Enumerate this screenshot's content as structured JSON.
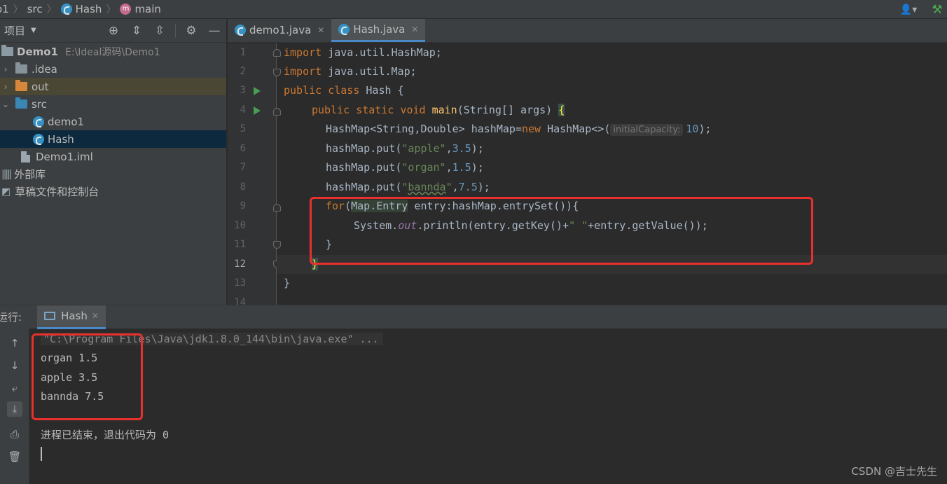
{
  "breadcrumb": {
    "project": "o1",
    "src": "src",
    "file": "Hash",
    "method": "main"
  },
  "project_panel": {
    "title": "项目",
    "tree": [
      {
        "label": "Demo1",
        "path": "E:\\Ideal源码\\Demo1"
      },
      {
        "label": ".idea"
      },
      {
        "label": "out"
      },
      {
        "label": "src"
      },
      {
        "label": "demo1"
      },
      {
        "label": "Hash"
      },
      {
        "label": "Demo1.iml"
      },
      {
        "label": "外部库"
      },
      {
        "label": "草稿文件和控制台"
      }
    ]
  },
  "editor": {
    "tabs": [
      {
        "label": "demo1.java"
      },
      {
        "label": "Hash.java"
      }
    ],
    "line_numbers": [
      "1",
      "2",
      "3",
      "4",
      "5",
      "6",
      "7",
      "8",
      "9",
      "10",
      "11",
      "12",
      "13",
      "14"
    ],
    "current_line": "12",
    "code": {
      "l1_kw": "import",
      "l1_rest": " java.util.HashMap;",
      "l2_kw": "import",
      "l2_rest": " java.util.Map;",
      "l3_kw": "public class",
      "l3_rest": " Hash {",
      "l4_kw": "public static void",
      "l4_fn": "main",
      "l4_rest": "(String[] args) ",
      "l4_brace": "{",
      "l5_a": "HashMap<String,Double> hashMap=",
      "l5_kw": "new",
      "l5_b": " HashMap<>(",
      "l5_hint": "initialCapacity:",
      "l5_num": "10",
      "l5_c": ");",
      "l6_a": "hashMap.put(",
      "l6_str": "\"apple\"",
      "l6_b": ",",
      "l6_num": "3.5",
      "l6_c": ");",
      "l7_a": "hashMap.put(",
      "l7_str": "\"organ\"",
      "l7_b": ",",
      "l7_num": "1.5",
      "l7_c": ");",
      "l8_a": "hashMap.put(",
      "l8_str_q1": "\"",
      "l8_str": "bannda",
      "l8_str_q2": "\"",
      "l8_b": ",",
      "l8_num": "7.5",
      "l8_c": ");",
      "l9_kw": "for",
      "l9_a": "(",
      "l9_hl": "Map.Entry",
      "l9_b": " entry:hashMap.entrySet()){",
      "l10_a": "System.",
      "l10_itl": "out",
      "l10_b": ".println(entry.getKey()+",
      "l10_str": "\" \"",
      "l10_c": "+entry.getValue());",
      "l11": "}",
      "l12": "}",
      "l13": "}"
    }
  },
  "run_panel": {
    "label": "运行:",
    "tab": "Hash",
    "command": "\"C:\\Program Files\\Java\\jdk1.8.0_144\\bin\\java.exe\" ...",
    "output": [
      "organ 1.5",
      "apple 3.5",
      "bannda 7.5"
    ],
    "exit_message": "进程已结束，退出代码为 0"
  },
  "watermark": "CSDN @吉士先生"
}
